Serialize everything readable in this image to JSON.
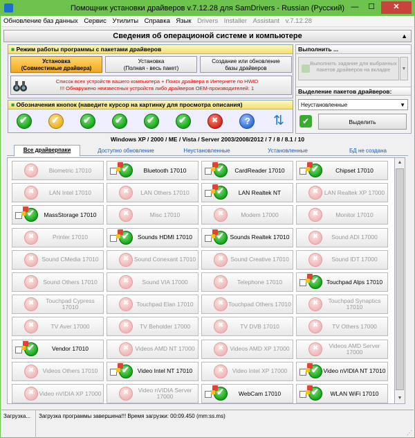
{
  "window": {
    "title": "Помощник установки драйверов v.7.12.28 для SamDrivers - Russian (Русский)",
    "minimize": "—",
    "maximize": "☐",
    "close": "✕"
  },
  "menu": [
    "Обновление баз данных",
    "Сервис",
    "Утилиты",
    "Справка",
    "Язык"
  ],
  "menu_gray": [
    "Drivers",
    "Installer",
    "Assistant",
    "v.7.12.28"
  ],
  "header": {
    "title": "Сведения об операционой системе и компьютере",
    "arrow": "▲"
  },
  "mode_panel": {
    "title": "Режим работы программы с пакетами драйверов",
    "btn_install": "Установка\n(Совместимые драйвера)",
    "btn_install_full": "Установка\n(Полная - весь пакет)",
    "btn_create": "Создание или обновление\nбазы драйверов",
    "warn1": "Список всех устройств вашего компьютера + Поиск драйвера в Интернете по HWID",
    "warn2": "!!! Обнаружено неизвестных устройств либо драйверов OEM-производителей: 1"
  },
  "legend_panel": {
    "title": "Обозначения кнопок (наведите курсор на картинку для просмотра описания)"
  },
  "right_panel": {
    "exec_title": "Выполнить ...",
    "exec_btn": "Выполнить задание для выбранных пакетов драйверов на вкладке",
    "exec_arrow": "▼",
    "select_title": "Выделение пакетов драйверов:",
    "select_value": "Неустановленные",
    "select_arrow": "▼",
    "select_btn": "Выделить",
    "select_check": "✔"
  },
  "os_line": "Windows XP / 2000 / ME / Vista / Server 2003/2008/2012 / 7 / 8 / 8.1 / 10",
  "tabs": [
    "Все драйверпаки",
    "Доступно обновление",
    "Неустановленные",
    "Установленные",
    "БД не создана"
  ],
  "grid": [
    [
      {
        "label": "Biometric 17010",
        "en": false
      },
      {
        "label": "Bluetooth 17010",
        "en": true
      },
      {
        "label": "CardReader 17010",
        "en": true
      },
      {
        "label": "Chipset 17010",
        "en": true
      }
    ],
    [
      {
        "label": "LAN Intel 17010",
        "en": false
      },
      {
        "label": "LAN Others 17010",
        "en": false
      },
      {
        "label": "LAN Realtek NT",
        "en": true
      },
      {
        "label": "LAN Realtek XP 17000",
        "en": false
      }
    ],
    [
      {
        "label": "MassStorage 17010",
        "en": true
      },
      {
        "label": "Misc 17010",
        "en": false
      },
      {
        "label": "Modem 17000",
        "en": false
      },
      {
        "label": "Monitor 17010",
        "en": false
      }
    ],
    [
      {
        "label": "Printer 17010",
        "en": false
      },
      {
        "label": "Sounds HDMI 17010",
        "en": true
      },
      {
        "label": "Sounds Realtek 17010",
        "en": true
      },
      {
        "label": "Sound ADI 17000",
        "en": false
      }
    ],
    [
      {
        "label": "Sound CMedia 17010",
        "en": false
      },
      {
        "label": "Sound Conexant 17010",
        "en": false
      },
      {
        "label": "Sound Creative 17010",
        "en": false
      },
      {
        "label": "Sound IDT 17000",
        "en": false
      }
    ],
    [
      {
        "label": "Sound Others 17010",
        "en": false
      },
      {
        "label": "Sound VIA 17000",
        "en": false
      },
      {
        "label": "Telephone 17010",
        "en": false
      },
      {
        "label": "Touchpad Alps 17010",
        "en": true
      }
    ],
    [
      {
        "label": "Touchpad Cypress 17010",
        "en": false
      },
      {
        "label": "Touchpad Elan 17010",
        "en": false
      },
      {
        "label": "Touchpad Others 17010",
        "en": false
      },
      {
        "label": "Touchpad Synaptics 17010",
        "en": false
      }
    ],
    [
      {
        "label": "TV Aver 17000",
        "en": false
      },
      {
        "label": "TV Beholder 17000",
        "en": false
      },
      {
        "label": "TV DVB 17010",
        "en": false
      },
      {
        "label": "TV Others 17000",
        "en": false
      }
    ],
    [
      {
        "label": "Vendor 17010",
        "en": true
      },
      {
        "label": "Videos AMD NT 17000",
        "en": false
      },
      {
        "label": "Videos AMD XP 17000",
        "en": false
      },
      {
        "label": "Videos AMD Server 17000",
        "en": false
      }
    ],
    [
      {
        "label": "Videos Others 17010",
        "en": false
      },
      {
        "label": "Video Intel NT 17010",
        "en": true
      },
      {
        "label": "Video Intel XP 17000",
        "en": false
      },
      {
        "label": "Video nVIDIA NT 17010",
        "en": true
      }
    ],
    [
      {
        "label": "Video nVIDIA XP 17000",
        "en": false
      },
      {
        "label": "Video nVIDIA Server 17000",
        "en": false
      },
      {
        "label": "WebCam 17010",
        "en": true
      },
      {
        "label": "WLAN WiFi 17010",
        "en": true
      }
    ]
  ],
  "scroll": {
    "up": "▲",
    "down": "▼"
  },
  "status": {
    "left": "Загрузка...",
    "right": "Загрузка программы завершена!!! Время загрузки: 00:09.450 (mm:ss.ms)",
    "grip": "⋰"
  },
  "colors": {
    "accent": "#6ec34e",
    "selected": "#f4a820",
    "warn": "#dd0000"
  }
}
